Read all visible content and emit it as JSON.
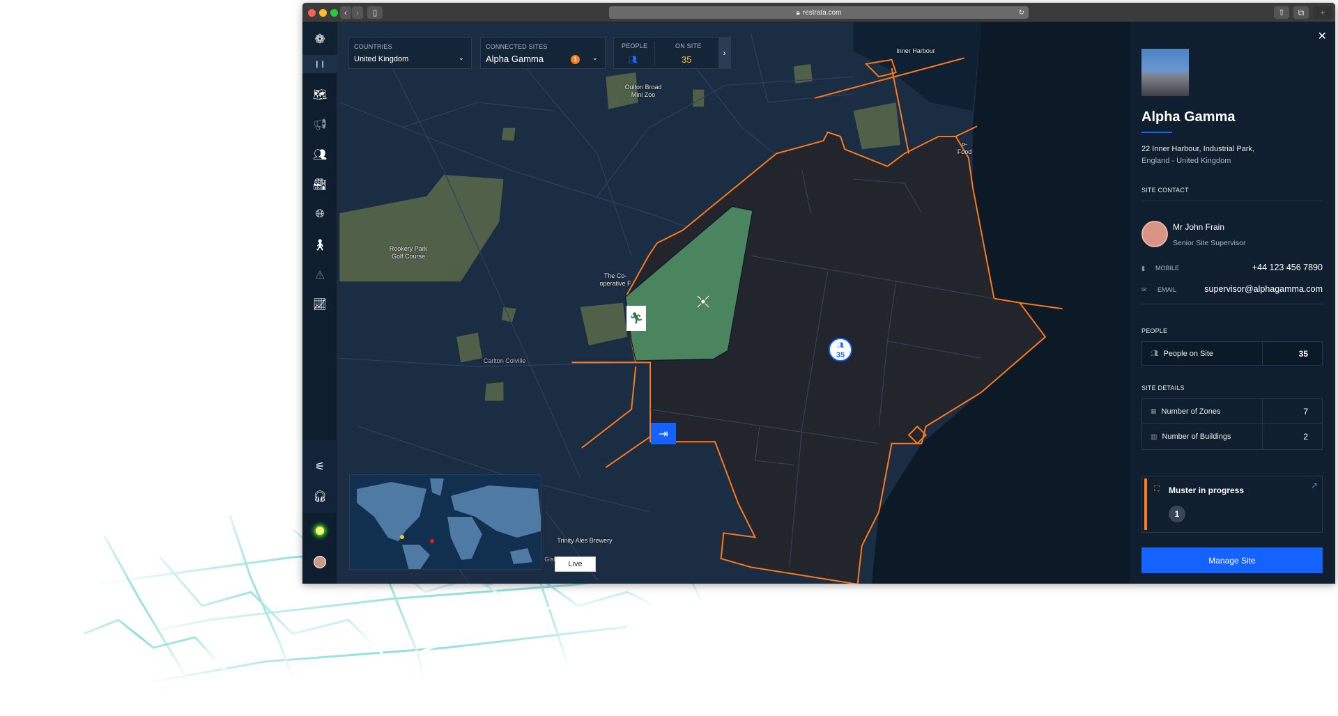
{
  "browser": {
    "url": "restrata.com"
  },
  "filters": {
    "countries": {
      "label": "COUNTRIES",
      "value": "United Kingdom"
    },
    "sites": {
      "label": "CONNECTED SITES",
      "value": "Alpha Gamma",
      "badge": "1"
    },
    "people": {
      "label": "PEOPLE",
      "on_site_label": "ON SITE",
      "on_site_value": "35"
    }
  },
  "map": {
    "labels": {
      "inner_harbour": "Inner Harbour",
      "zoo1": "Oulton Broad",
      "zoo2": "Mini Zoo",
      "golf1": "Rookery Park",
      "golf2": "Golf Course",
      "coop1": "The Co-",
      "coop2": "operative F",
      "carlton": "Carlton Colville",
      "food1": "o-",
      "food2": "Food",
      "brewery": "Trinity Ales Brewery",
      "gisl": "Gisl"
    },
    "people_marker": "35",
    "live_button": "Live",
    "colors": {
      "site_outline": "#ff7a1a",
      "assembly_zone": "#4a8560",
      "marker": "#1463ff"
    }
  },
  "panel": {
    "title": "Alpha Gamma",
    "address1": "22 Inner Harbour, Industrial Park,",
    "address2": "England - United Kingdom",
    "site_contact_label": "SITE CONTACT",
    "contact": {
      "name": "Mr John Frain",
      "role": "Senior Site Supervisor",
      "mobile_label": "MOBILE",
      "mobile": "+44 123 456 7890",
      "email_label": "EMAIL",
      "email": "supervisor@alphagamma.com"
    },
    "people_label": "PEOPLE",
    "people_rows": [
      {
        "label": "People on Site",
        "value": "35"
      }
    ],
    "site_details_label": "SITE DETAILS",
    "details_rows": [
      {
        "label": "Number of Zones",
        "value": "7"
      },
      {
        "label": "Number of Buildings",
        "value": "2"
      }
    ],
    "muster": {
      "title": "Muster in progress",
      "count": "1"
    },
    "manage_button": "Manage Site"
  },
  "sidebar": {
    "items": [
      "layers-map-icon",
      "megaphone-icon",
      "people-group-icon",
      "factory-icon",
      "globe-icon",
      "traveller-icon",
      "alert-icon",
      "analytics-icon",
      "settings-sliders-icon",
      "support-agent-icon",
      "status-indicator-icon",
      "user-avatar"
    ]
  }
}
